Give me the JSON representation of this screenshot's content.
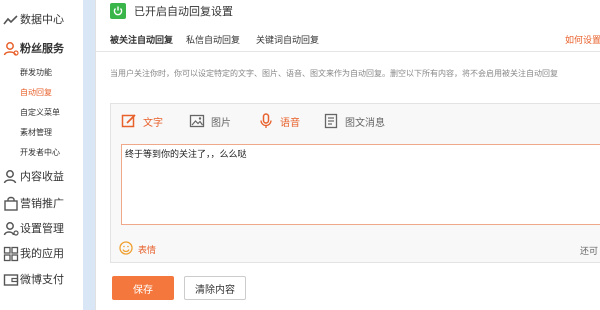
{
  "sidebar": {
    "data_center": "数据中心",
    "fans_service": "粉丝服务",
    "sub_items": [
      "群发功能",
      "自动回复",
      "自定义菜单",
      "素材管理",
      "开发者中心"
    ],
    "active_sub_index": 1,
    "content_revenue": "内容收益",
    "marketing": "营销推广",
    "settings": "设置管理",
    "my_apps": "我的应用",
    "weibo_pay": "微博支付"
  },
  "header": {
    "title": "已开启自动回复设置"
  },
  "tabs": {
    "items": [
      "被关注自动回复",
      "私信自动回复",
      "关键词自动回复"
    ],
    "active_index": 0,
    "help_link": "如何设置"
  },
  "hint_text": "当用户关注你时，你可以设定特定的文字、图片、语音、图文来作为自动回复。删空以下所有内容，将不会启用被关注自动回复",
  "editor": {
    "tools": [
      "文字",
      "图片",
      "语音",
      "图文消息"
    ],
    "active_tool_index": 0,
    "content": "终于等到你的关注了，，么么哒",
    "emoji_label": "表情",
    "remaining_label": "还可"
  },
  "actions": {
    "save": "保存",
    "clear": "清除内容"
  },
  "colors": {
    "accent": "#e8602b",
    "save_button": "#f4783d",
    "power_icon": "#39b54a"
  }
}
